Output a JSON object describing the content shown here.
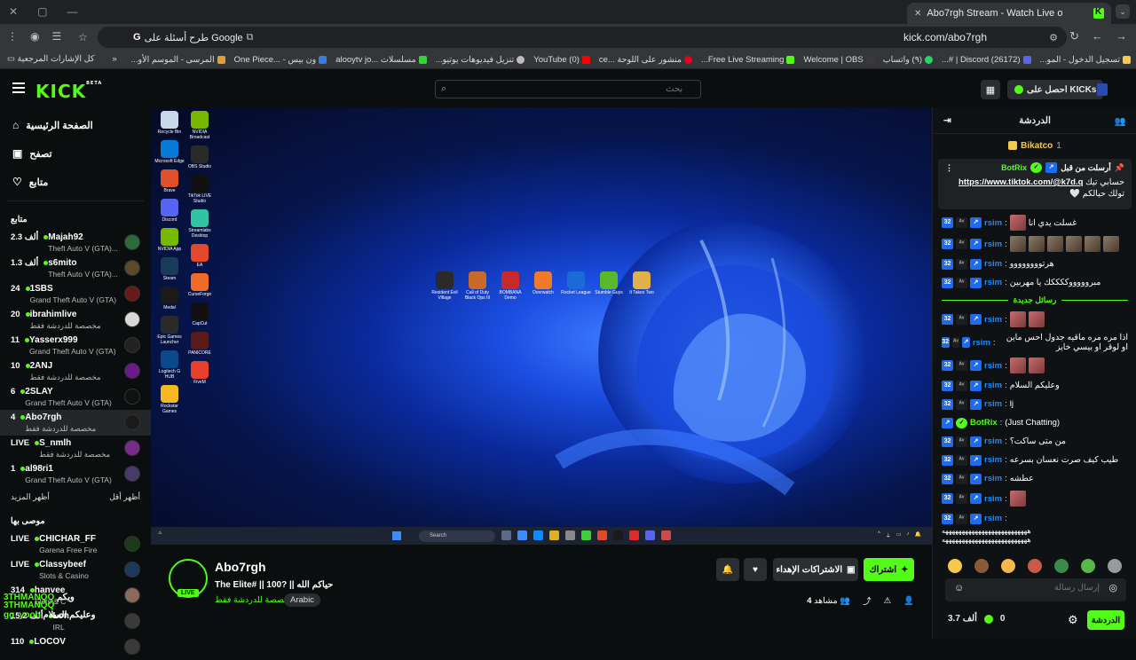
{
  "browser": {
    "tab_title": "Abo7rgh Stream - Watch Live o",
    "url": "kick.com/abo7rgh",
    "omnibox_ask": "طرح أسئلة على Google",
    "bookmarks": [
      "تسجيل الدخول - المو...",
      "(26172) Discord | #...",
      "(٩) واتساب",
      "Welcome | OBS",
      "Free Live Streaming...",
      "منشور على اللوحة ...ce",
      "(0) YouTube",
      "تنزيل فيديوهات يوتيو...",
      "مسلسلات ...alooytv jo",
      "ون بيس - ...One Piece",
      "المرسى - الموسم الأو..."
    ],
    "bookmarks_folder": "كل الإشارات المرجعية"
  },
  "header": {
    "logo": "KICK",
    "logo_beta": "BETA",
    "search_placeholder": "بحث",
    "get_kicks": "احصل على KICKs"
  },
  "sidebar": {
    "nav": [
      {
        "label": "الصفحة الرئيسية",
        "icon": "home-icon"
      },
      {
        "label": "تصفح",
        "icon": "browse-icon"
      },
      {
        "label": "متابع",
        "icon": "heart-icon"
      }
    ],
    "following_heading": "متابع",
    "following": [
      {
        "name": "Majah92",
        "viewers": "2.3 ألف",
        "category": "Theft Auto V (GTA)...",
        "avatar_color": "#2b6b3a"
      },
      {
        "name": "s6mito",
        "viewers": "1.3 ألف",
        "category": "Theft Auto V (GTA)...",
        "avatar_color": "#5a4a2a"
      },
      {
        "name": "1SBS",
        "viewers": "24",
        "category": "Grand Theft Auto V (GTA)",
        "avatar_color": "#6b1a1a"
      },
      {
        "name": "ibrahimlive",
        "viewers": "20",
        "category": "مخصصة للدردشة فقط",
        "avatar_color": "#d8d8d8"
      },
      {
        "name": "Yasserx999",
        "viewers": "11",
        "category": "Grand Theft Auto V (GTA)",
        "avatar_color": "#222222"
      },
      {
        "name": "2ANJ",
        "viewers": "10",
        "category": "مخصصة للدردشة فقط",
        "avatar_color": "#6a1a8a"
      },
      {
        "name": "2SLAY",
        "viewers": "6",
        "category": "Grand Theft Auto V (GTA)",
        "avatar_color": "#111111"
      },
      {
        "name": "Abo7rgh",
        "viewers": "4",
        "category": "مخصصة للدردشة فقط",
        "avatar_color": "#1a1a1a"
      },
      {
        "name": "S_nmlh",
        "viewers": "LIVE",
        "category": "مخصصة للدردشة فقط",
        "avatar_color": "#7a2a8a"
      },
      {
        "name": "al98ri1",
        "viewers": "1",
        "category": "Grand Theft Auto V (GTA)",
        "avatar_color": "#4a3a6a"
      }
    ],
    "show_more": "أظهر المزيد",
    "show_less": "أظهر أقل",
    "recommended_heading": "موصى بها",
    "recommended": [
      {
        "name": "CHICHAR_FF",
        "viewers": "LIVE",
        "category": "Garena Free Fire",
        "avatar_color": "#1a3a1a"
      },
      {
        "name": "Classybeef",
        "viewers": "LIVE",
        "category": "Slots & Casino",
        "avatar_color": "#1a3a5a"
      },
      {
        "name": "hanvee",
        "viewers": "314",
        "category": "Slots & C",
        "avatar_color": "#8a6a5a"
      },
      {
        "name": "Lon",
        "viewers": "15.2 ألف",
        "category": "IRL",
        "avatar_color": "#3a3a3a"
      },
      {
        "name": "LOCOV",
        "viewers": "110",
        "category": "",
        "avatar_color": "#3a3a3a"
      }
    ]
  },
  "stream": {
    "name": "Abo7rgh",
    "live": "LIVE",
    "title": "The Elite# || حياكم الله || ?100",
    "category": "مخصصة للدردشة فقط",
    "language": "Arabic",
    "subscribe": "اشتراك",
    "gift_subs": "الاشتراكات الإهداء",
    "viewers_label": "مشاهد",
    "viewers": "4"
  },
  "overlay_chat": [
    {
      "user": "3THMANQQ",
      "text": "ويكم"
    },
    {
      "user": "3THMANQQ",
      "text": ""
    },
    {
      "user": "gg_yooh",
      "text": "وعليكم السلام"
    }
  ],
  "desktop": {
    "left_icons": [
      "Recycle Bin",
      "Microsoft Edge",
      "Brave",
      "Discord",
      "NVIDIA App",
      "Steam",
      "Medal",
      "Epic Games Launcher",
      "Logitech G HUB",
      "Rockstar Games"
    ],
    "right_icons": [
      "NVIDIA Broadcast",
      "OBS Studio",
      "TikTok LIVE Studio",
      "Streamlabs Desktop",
      "EA",
      "CurseForge",
      "CapCut",
      "PANICORE",
      "FiveM"
    ],
    "games": [
      "Resident Evil Village",
      "Call of Duty Black Ops III",
      "BOMBANA Demo",
      "Overwatch",
      "Rocket League",
      "Stumble Guys",
      "It Takes Two"
    ],
    "taskbar_search": "Search"
  },
  "chat": {
    "title": "الدردشة",
    "top_gifter": "Bikatco",
    "top_gifter_count": "1",
    "pinned_by_label": "أرسلت من قبل",
    "pinned_by": "BotRix",
    "pinned_text_pre": "حسابي تيك",
    "pinned_link": "https://www.tiktok.com/@k7d.q",
    "pinned_text_post": "تولك حيالكم",
    "new_messages": "رسائل جديدة",
    "messages": [
      {
        "user": "rsim",
        "text": "غسلت يدي انا",
        "emotes": 1
      },
      {
        "user": "rsim",
        "text": "",
        "emotes": 6
      },
      {
        "user": "rsim",
        "text": "هرتوووووووو",
        "emotes": 0
      },
      {
        "user": "rsim",
        "text": "مبروووووككككك يا مهربين",
        "emotes": 0
      },
      {
        "sep": true
      },
      {
        "user": "rsim",
        "text": "",
        "emotes": 2
      },
      {
        "user": "rsim",
        "text": "اذا مره مره ماقيه جدول احس ماين او لوقر او بيسي خايز",
        "emotes": 0
      },
      {
        "user": "rsim",
        "text": "",
        "emotes": 2
      },
      {
        "user": "rsim",
        "text": "وعليكم السلام",
        "emotes": 0
      },
      {
        "user": "rsim",
        "text": "lj",
        "emotes": 0
      },
      {
        "user": "BotRix",
        "text": "(Just Chatting)",
        "emotes": 0,
        "bot": true
      },
      {
        "user": "rsim",
        "text": "من متى ساكت؟",
        "emotes": 0
      },
      {
        "user": "rsim",
        "text": "طيب كيف صرت نعسان بسرعه",
        "emotes": 0
      },
      {
        "user": "rsim",
        "text": "عطشه",
        "emotes": 0
      },
      {
        "user": "rsim",
        "text": "",
        "emotes": 1
      },
      {
        "user": "rsim",
        "text": "",
        "emotes": 0
      }
    ],
    "spam_line": "ههههههههههههههههههههههههههه",
    "input_placeholder": "إرسال رسالة",
    "kicks_balance": "3.7 ألف",
    "kicks_points": "0",
    "send": "الدردشة"
  }
}
